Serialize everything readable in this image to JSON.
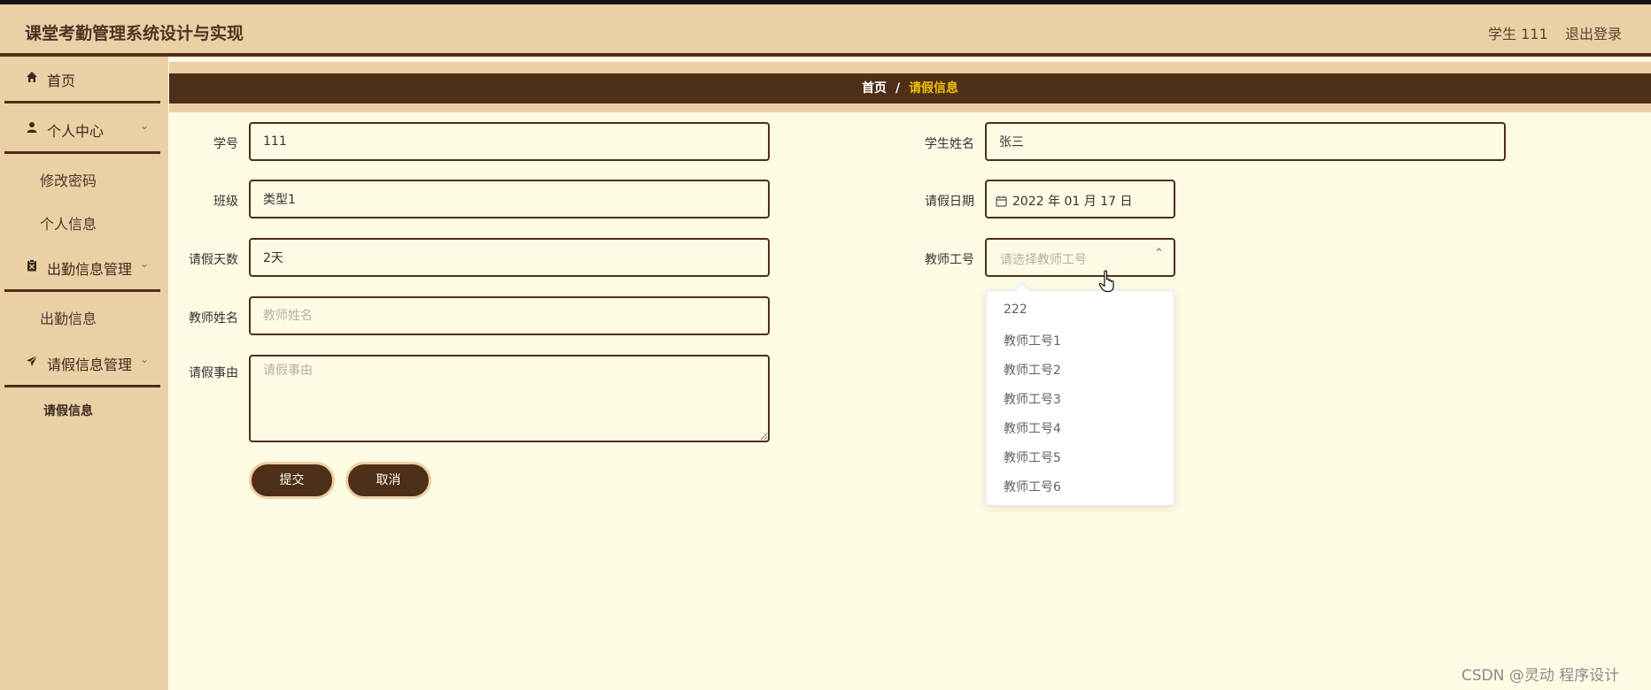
{
  "header": {
    "title": "课堂考勤管理系统设计与实现",
    "user": "学生 111",
    "logout": "退出登录"
  },
  "sidebar": {
    "home": "首页",
    "personal_center": "个人中心",
    "change_password": "修改密码",
    "personal_info": "个人信息",
    "attendance_mgmt": "出勤信息管理",
    "attendance_info": "出勤信息",
    "leave_mgmt": "请假信息管理",
    "leave_info": "请假信息"
  },
  "breadcrumb": {
    "home": "首页",
    "separator": "/",
    "current": "请假信息"
  },
  "form": {
    "student_id": {
      "label": "学号",
      "value": "111"
    },
    "student_name": {
      "label": "学生姓名",
      "value": "张三"
    },
    "class": {
      "label": "班级",
      "value": "类型1"
    },
    "leave_date": {
      "label": "请假日期",
      "value": "2022 年 01 月 17 日"
    },
    "leave_days": {
      "label": "请假天数",
      "value": "2天"
    },
    "teacher_id": {
      "label": "教师工号",
      "placeholder": "请选择教师工号"
    },
    "teacher_name": {
      "label": "教师姓名",
      "placeholder": "教师姓名"
    },
    "reason": {
      "label": "请假事由",
      "placeholder": "请假事由"
    },
    "submit": "提交",
    "cancel": "取消"
  },
  "teacher_options": [
    "222",
    "教师工号1",
    "教师工号2",
    "教师工号3",
    "教师工号4",
    "教师工号5",
    "教师工号6"
  ],
  "watermark": "CSDN @灵动 程序设计",
  "colors": {
    "primary": "#4e2f17",
    "sidebar_bg": "#ecd0a5",
    "content_bg": "#fefbe4",
    "breadcrumb_current": "#f2c100"
  }
}
